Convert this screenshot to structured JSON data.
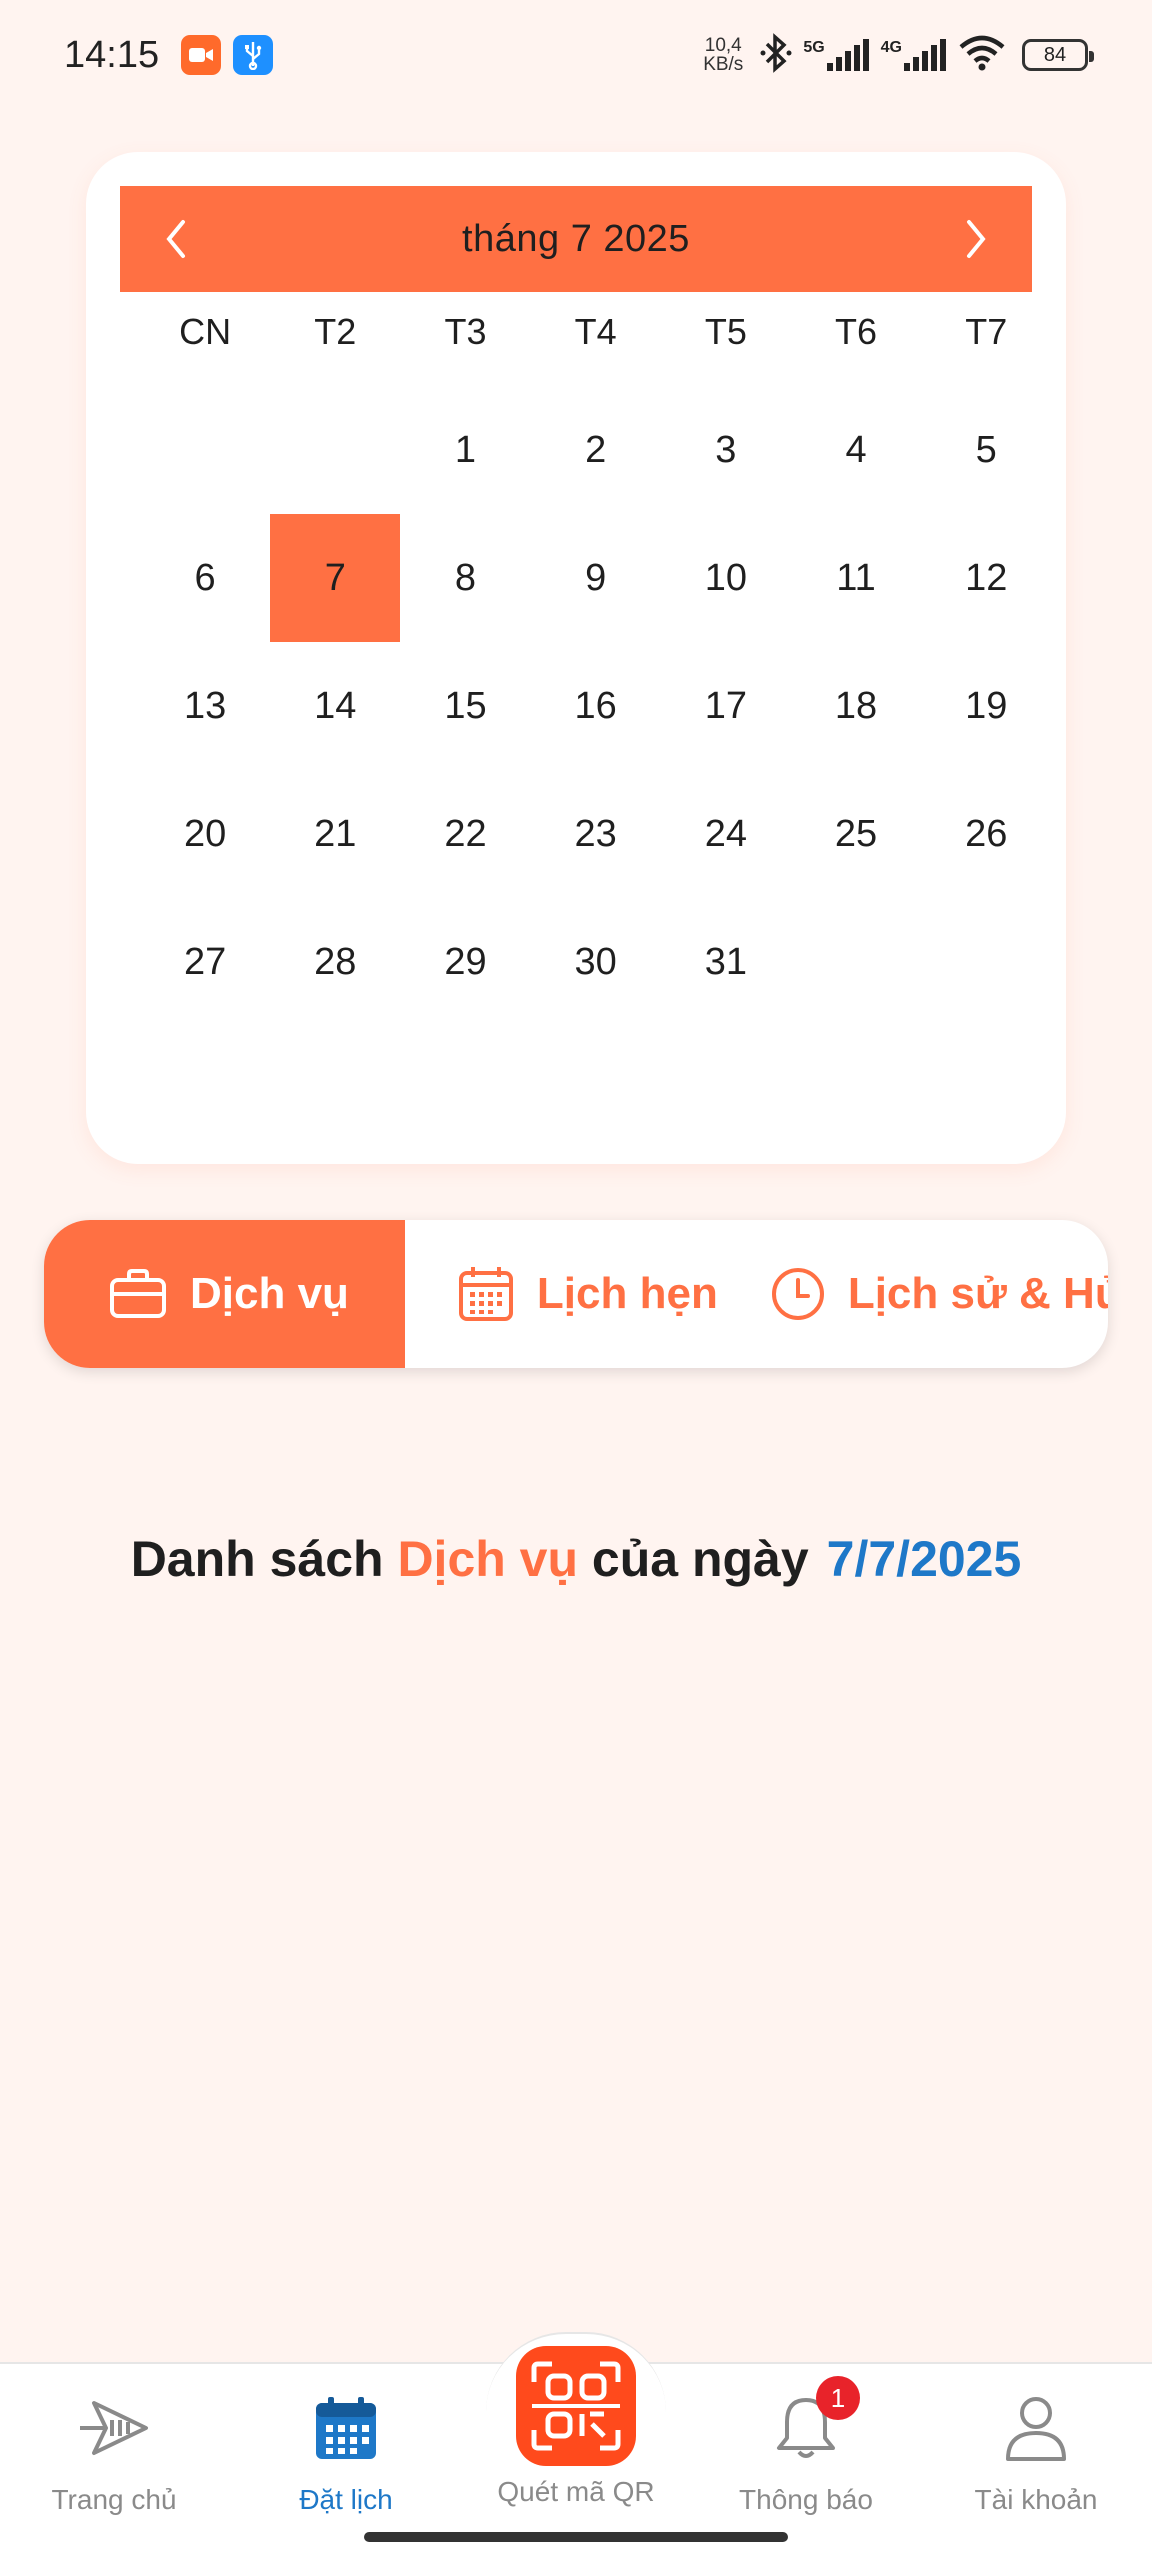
{
  "status_bar": {
    "time": "14:15",
    "speed_value": "10,4",
    "speed_unit": "KB/s",
    "sim1_label": "5G",
    "sim2_label": "4G",
    "battery": "84"
  },
  "calendar": {
    "title": "tháng 7 2025",
    "weekdays": [
      "CN",
      "T2",
      "T3",
      "T4",
      "T5",
      "T6",
      "T7"
    ],
    "leading_blanks": 2,
    "days": [
      "1",
      "2",
      "3",
      "4",
      "5",
      "6",
      "7",
      "8",
      "9",
      "10",
      "11",
      "12",
      "13",
      "14",
      "15",
      "16",
      "17",
      "18",
      "19",
      "20",
      "21",
      "22",
      "23",
      "24",
      "25",
      "26",
      "27",
      "28",
      "29",
      "30",
      "31"
    ],
    "selected_day": "7",
    "accent_color": "#ff7043"
  },
  "tabs": {
    "items": [
      {
        "label": "Dịch vụ",
        "icon": "briefcase-icon",
        "active": true
      },
      {
        "label": "Lịch hẹn",
        "icon": "calendar-grid-icon",
        "active": false
      },
      {
        "label": "Lịch sử & Hủy",
        "icon": "clock-icon",
        "active": false
      }
    ]
  },
  "list_title": {
    "prefix": "Danh sách ",
    "highlight": "Dịch vụ",
    "middle": " của ngày",
    "date": "7/7/2025"
  },
  "bottom_nav": {
    "items": [
      {
        "label": "Trang chủ",
        "icon": "home-icon"
      },
      {
        "label": "Đặt lịch",
        "icon": "calendar-icon",
        "active": true
      },
      {
        "label": "Quét mã QR",
        "icon": "qr-scan-icon"
      },
      {
        "label": "Thông báo",
        "icon": "bell-icon",
        "badge": "1"
      },
      {
        "label": "Tài khoản",
        "icon": "user-icon"
      }
    ]
  }
}
